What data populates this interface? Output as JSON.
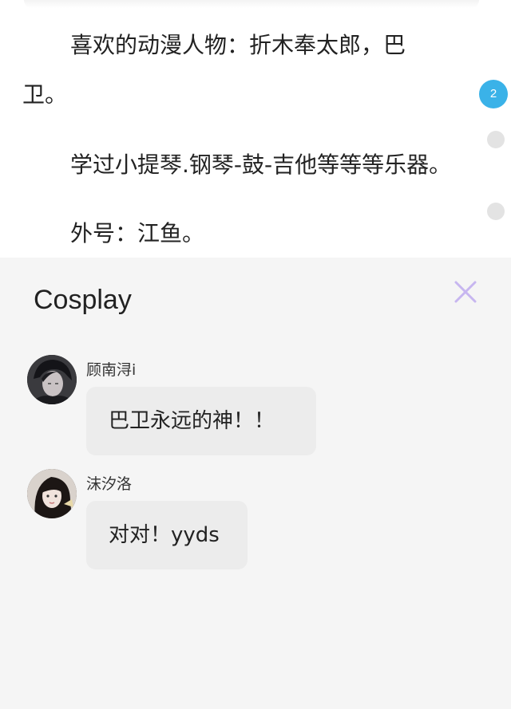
{
  "article": {
    "paragraphs": [
      {
        "line1": "喜欢的动漫人物：折木奉太郎，巴",
        "line2": "卫。"
      },
      {
        "line1": "学过小提琴.钢琴-鼓-吉他等等等乐器。"
      },
      {
        "line1": "外号：江鱼。"
      }
    ]
  },
  "scroll_indicator": {
    "active_label": "2",
    "active_color": "#3ab2e8"
  },
  "comments_panel": {
    "title": "Cosplay",
    "close_icon": "close-icon",
    "close_color": "#c7b6f0",
    "comments": [
      {
        "author": "顾南浔i",
        "text": "巴卫永远的神！！"
      },
      {
        "author": "沫汐洛",
        "text": "对对！yyds"
      }
    ]
  }
}
